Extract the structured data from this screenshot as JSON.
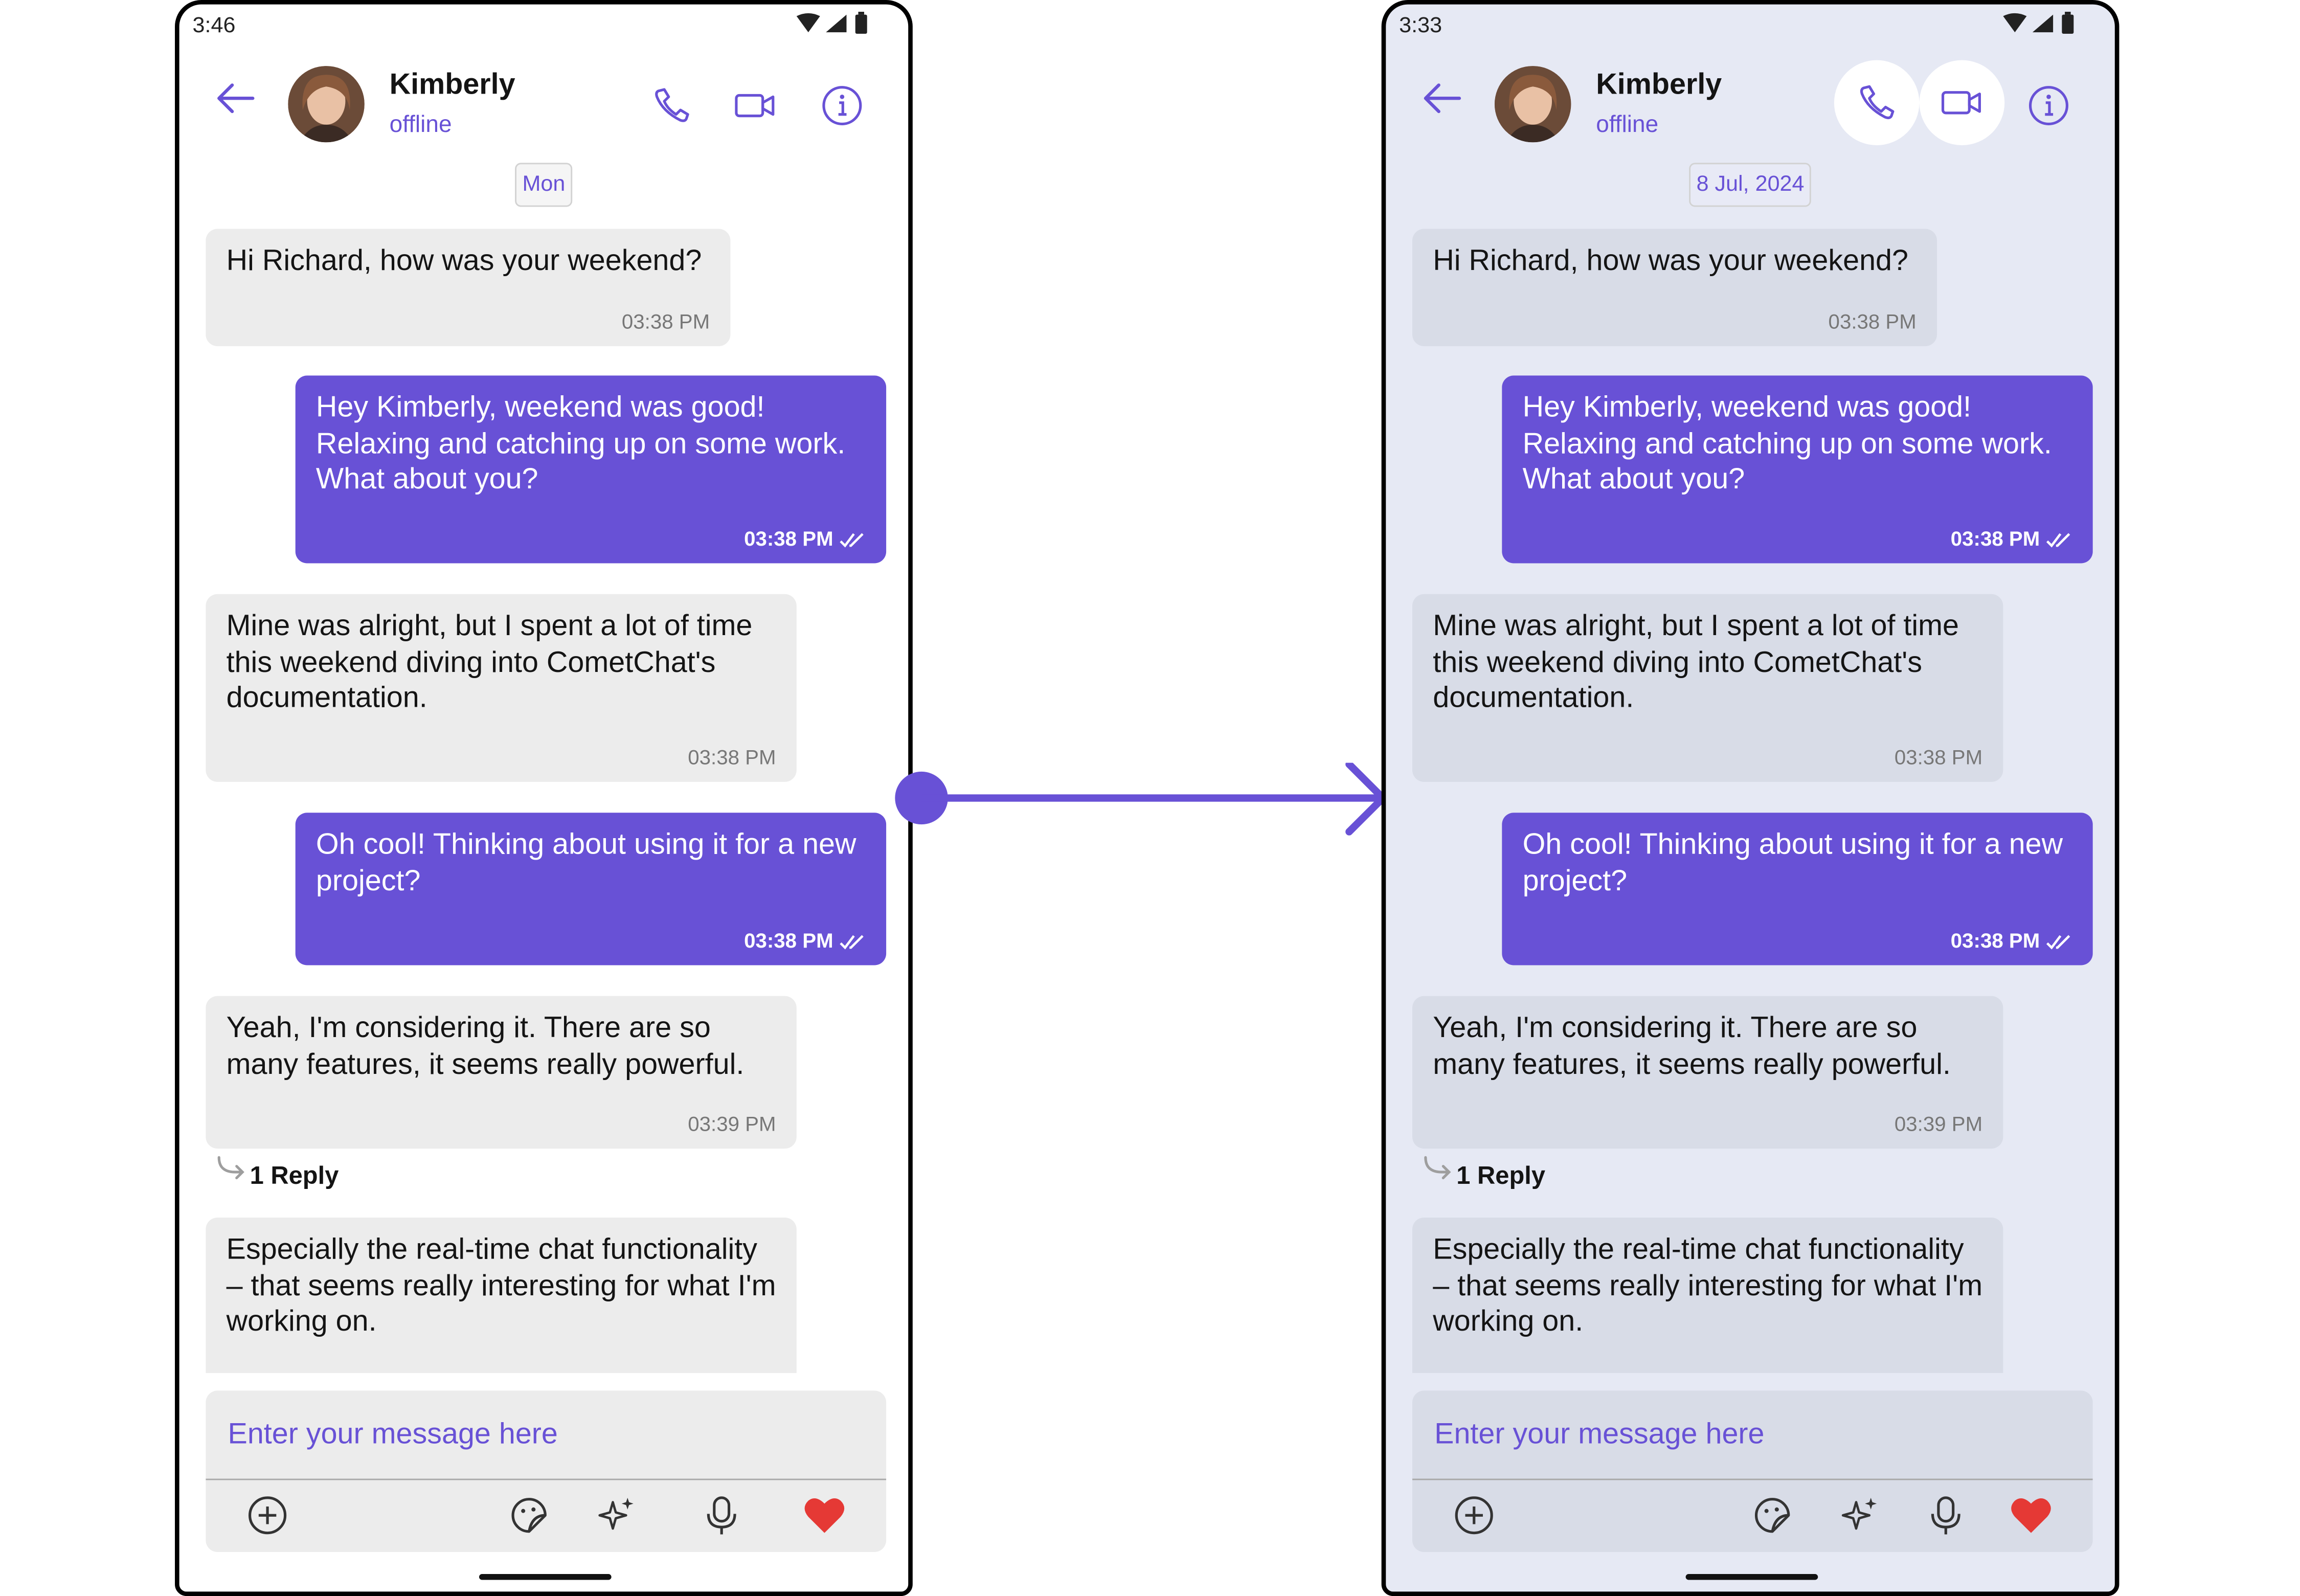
{
  "colors": {
    "accent": "#6851d6",
    "outgoing_bubble": "#6851d6",
    "incoming_bubble": "#ececec",
    "incoming_bubble_themed": "#d8dce7",
    "themed_background": "#e6e9f4",
    "heart": "#e53935"
  },
  "left_phone": {
    "status_time": "3:46",
    "date_separator": "Mon"
  },
  "right_phone": {
    "status_time": "3:33",
    "date_separator": "8 Jul, 2024"
  },
  "header": {
    "name": "Kimberly",
    "status": "offline",
    "icons": [
      "back-arrow-icon",
      "phone-call-icon",
      "video-call-icon",
      "info-icon"
    ]
  },
  "messages": [
    {
      "direction": "incoming",
      "text": "Hi Richard, how was your weekend?",
      "time": "03:38 PM"
    },
    {
      "direction": "outgoing",
      "text": "Hey Kimberly, weekend was good! Relaxing and catching up on some work. What about you?",
      "time": "03:38 PM",
      "receipt": "read"
    },
    {
      "direction": "incoming",
      "text": "Mine was alright, but I spent a lot of time this weekend diving into CometChat's documentation.",
      "time": "03:38 PM"
    },
    {
      "direction": "outgoing",
      "text": "Oh cool! Thinking about using it for a new project?",
      "time": "03:38 PM",
      "receipt": "read"
    },
    {
      "direction": "incoming",
      "text": "Yeah, I'm considering it.  There are so many features, it seems really powerful.",
      "time": "03:39 PM",
      "replies": "1 Reply"
    },
    {
      "direction": "incoming",
      "text": "Especially the real-time chat functionality – that seems really interesting for what I'm working on."
    }
  ],
  "composer": {
    "placeholder": "Enter your message here",
    "icons": [
      "add-attachment-icon",
      "sticker-icon",
      "ai-sparkle-icon",
      "microphone-icon",
      "heart-reaction-icon"
    ]
  }
}
